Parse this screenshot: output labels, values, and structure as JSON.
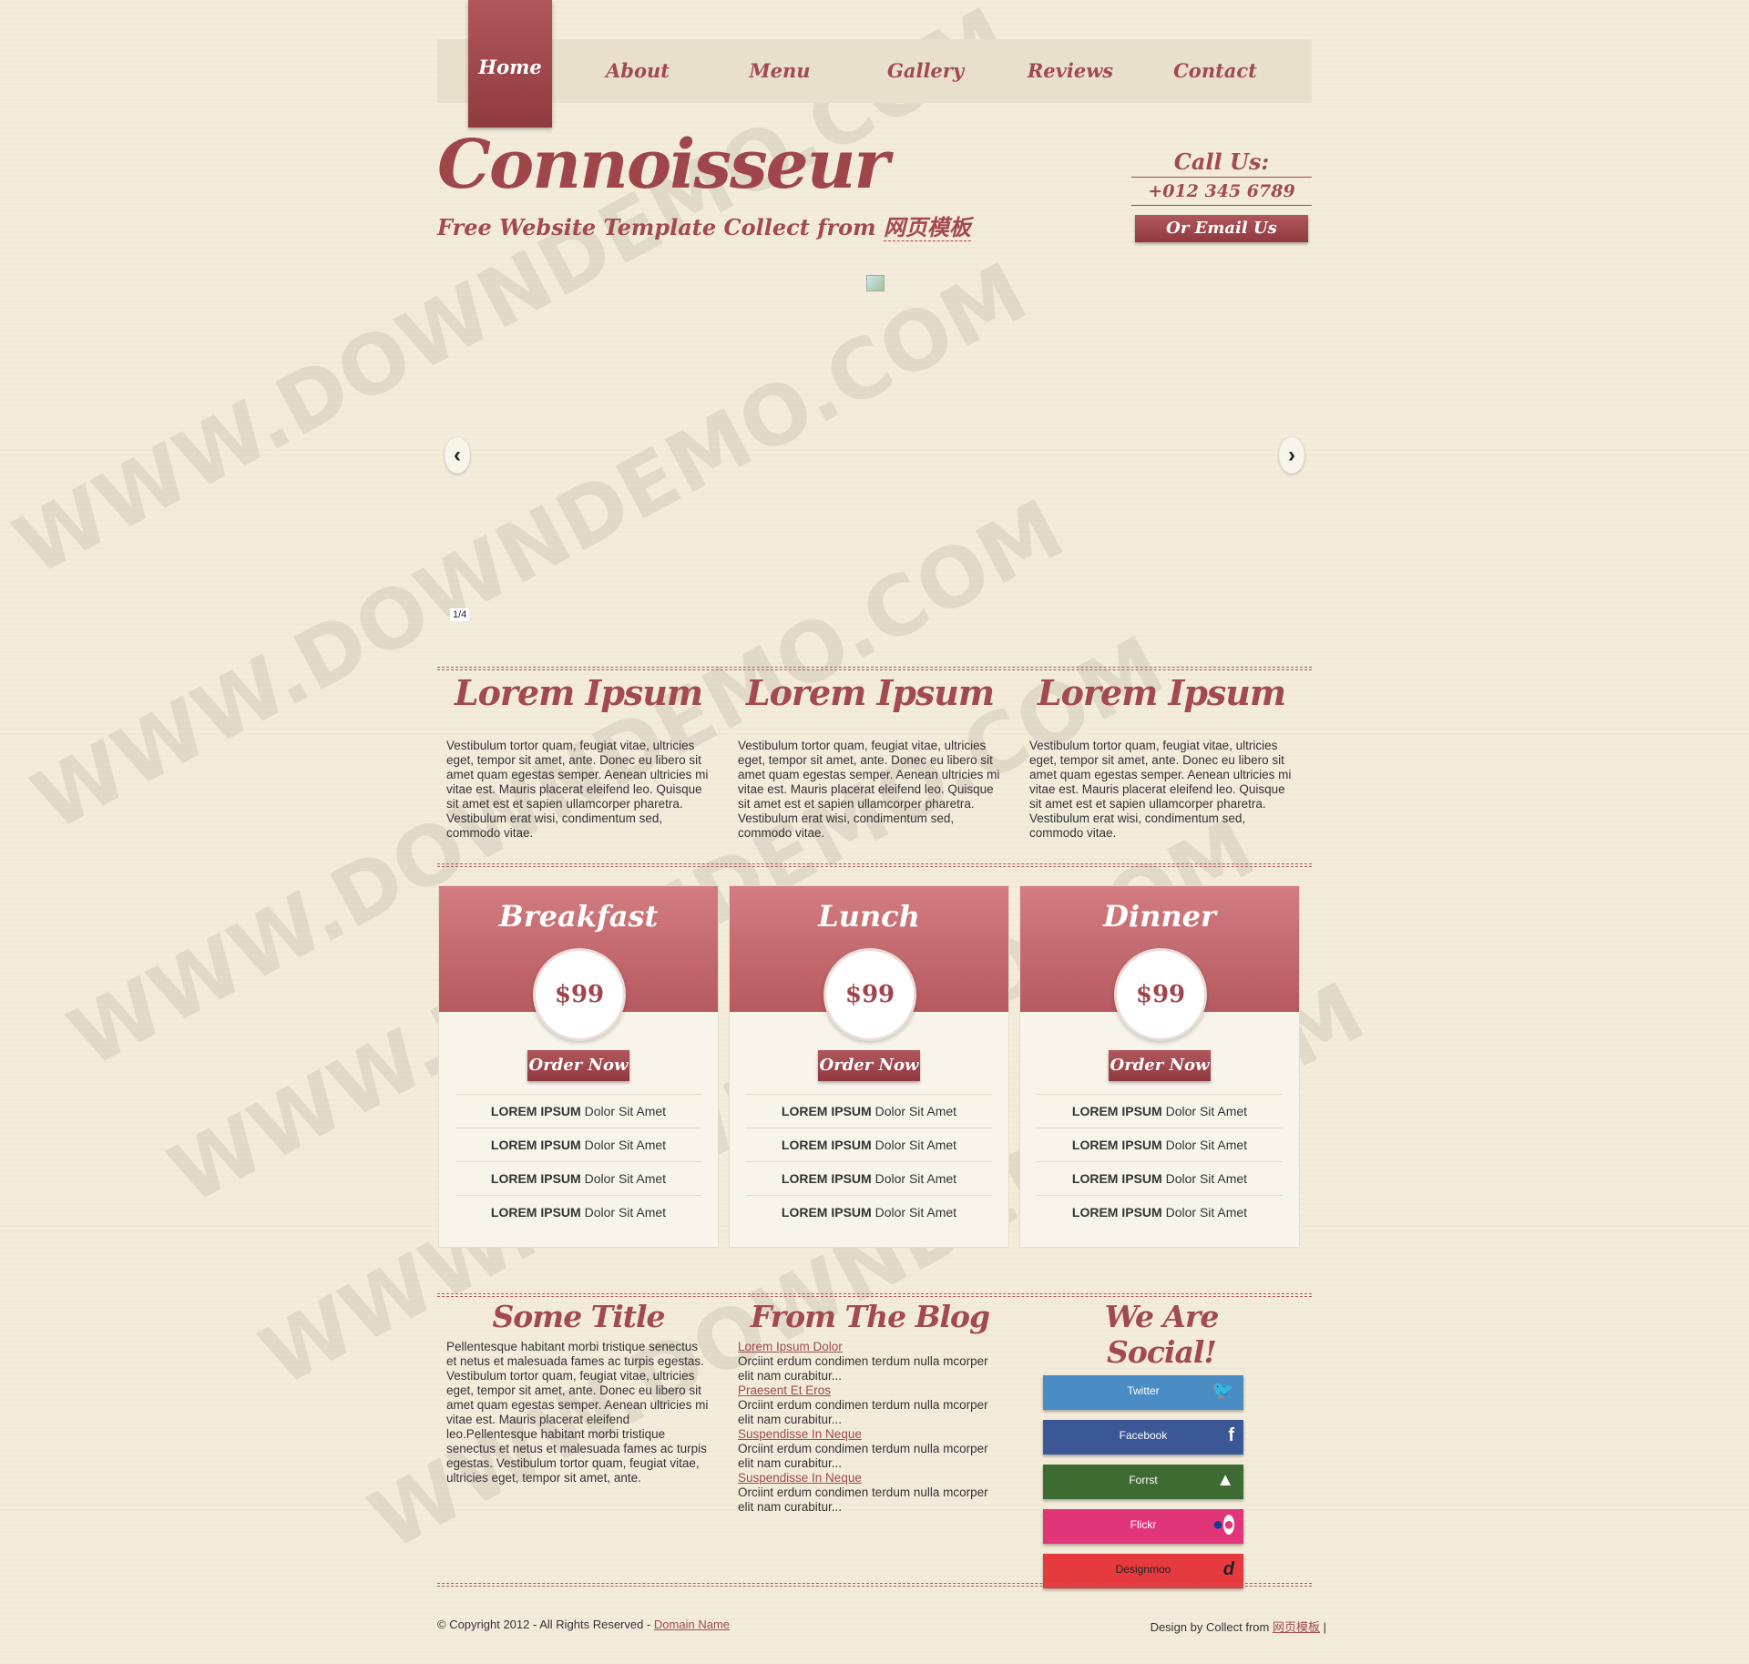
{
  "nav": {
    "home": "Home",
    "items": [
      "About",
      "Menu",
      "Gallery",
      "Reviews",
      "Contact"
    ]
  },
  "header": {
    "logo": "Connoisseur",
    "tagline_prefix": "Free Website Template Collect from",
    "tagline_link": "网页模板",
    "call_title": "Call Us:",
    "phone": "+012 345 6789",
    "email_button": "Or Email Us"
  },
  "slider": {
    "counter": "1/4",
    "prev_icon": "chevron-left-icon",
    "next_icon": "chevron-right-icon"
  },
  "intro": {
    "columns": [
      {
        "title": "Lorem Ipsum",
        "text": "Vestibulum tortor quam, feugiat vitae, ultricies eget, tempor sit amet, ante. Donec eu libero sit amet quam egestas semper. Aenean ultricies mi vitae est. Mauris placerat eleifend leo. Quisque sit amet est et sapien ullamcorper pharetra. Vestibulum erat wisi, condimentum sed, commodo vitae."
      },
      {
        "title": "Lorem Ipsum",
        "text": "Vestibulum tortor quam, feugiat vitae, ultricies eget, tempor sit amet, ante. Donec eu libero sit amet quam egestas semper. Aenean ultricies mi vitae est. Mauris placerat eleifend leo. Quisque sit amet est et sapien ullamcorper pharetra. Vestibulum erat wisi, condimentum sed, commodo vitae."
      },
      {
        "title": "Lorem Ipsum",
        "text": "Vestibulum tortor quam, feugiat vitae, ultricies eget, tempor sit amet, ante. Donec eu libero sit amet quam egestas semper. Aenean ultricies mi vitae est. Mauris placerat eleifend leo. Quisque sit amet est et sapien ullamcorper pharetra. Vestibulum erat wisi, condimentum sed, commodo vitae."
      }
    ]
  },
  "pricing": {
    "cards": [
      {
        "title": "Breakfast",
        "price": "$99",
        "button": "Order Now",
        "features": [
          {
            "bold": "LOREM IPSUM",
            "rest": " Dolor Sit Amet"
          },
          {
            "bold": "LOREM IPSUM",
            "rest": " Dolor Sit Amet"
          },
          {
            "bold": "LOREM IPSUM",
            "rest": " Dolor Sit Amet"
          },
          {
            "bold": "LOREM IPSUM",
            "rest": " Dolor Sit Amet"
          }
        ]
      },
      {
        "title": "Lunch",
        "price": "$99",
        "button": "Order Now",
        "features": [
          {
            "bold": "LOREM IPSUM",
            "rest": " Dolor Sit Amet"
          },
          {
            "bold": "LOREM IPSUM",
            "rest": " Dolor Sit Amet"
          },
          {
            "bold": "LOREM IPSUM",
            "rest": " Dolor Sit Amet"
          },
          {
            "bold": "LOREM IPSUM",
            "rest": " Dolor Sit Amet"
          }
        ]
      },
      {
        "title": "Dinner",
        "price": "$99",
        "button": "Order Now",
        "features": [
          {
            "bold": "LOREM IPSUM",
            "rest": " Dolor Sit Amet"
          },
          {
            "bold": "LOREM IPSUM",
            "rest": " Dolor Sit Amet"
          },
          {
            "bold": "LOREM IPSUM",
            "rest": " Dolor Sit Amet"
          },
          {
            "bold": "LOREM IPSUM",
            "rest": " Dolor Sit Amet"
          }
        ]
      }
    ]
  },
  "footer": {
    "some_title": "Some Title",
    "some_text": "Pellentesque habitant morbi tristique senectus et netus et malesuada fames ac turpis egestas. Vestibulum tortor quam, feugiat vitae, ultricies eget, tempor sit amet, ante. Donec eu libero sit amet quam egestas semper. Aenean ultricies mi vitae est. Mauris placerat eleifend leo.Pellentesque habitant morbi tristique senectus et netus et malesuada fames ac turpis egestas. Vestibulum tortor quam, feugiat vitae, ultricies eget, tempor sit amet, ante.",
    "blog_title": "From The Blog",
    "blog_posts": [
      {
        "title": "Lorem Ipsum Dolor",
        "text": "Orciint erdum condimen terdum nulla mcorper elit nam curabitur..."
      },
      {
        "title": "Praesent Et Eros",
        "text": "Orciint erdum condimen terdum nulla mcorper elit nam curabitur..."
      },
      {
        "title": "Suspendisse In Neque",
        "text": "Orciint erdum condimen terdum nulla mcorper elit nam curabitur..."
      },
      {
        "title": "Suspendisse In Neque",
        "text": "Orciint erdum condimen terdum nulla mcorper elit nam curabitur..."
      }
    ],
    "social_title": "We Are Social!",
    "social": [
      {
        "label": "Twitter",
        "icon": "twitter-icon",
        "color": "#4a8cc4"
      },
      {
        "label": "Facebook",
        "icon": "facebook-icon",
        "color": "#3b5796"
      },
      {
        "label": "Forrst",
        "icon": "forrst-icon",
        "color": "#3e6b32"
      },
      {
        "label": "Flickr",
        "icon": "flickr-icon",
        "color": "#e1357a"
      },
      {
        "label": "Designmoo",
        "icon": "designmoo-icon",
        "color": "#e53a3e"
      }
    ],
    "copyright_prefix": "© Copyright 2012 - All Rights Reserved -",
    "copyright_link": "Domain Name",
    "design_prefix": "Design by Collect from",
    "design_link": "网页模板",
    "design_suffix": "|"
  },
  "watermark": "WWW.DOWNDEMO.COM",
  "colors": {
    "accent": "#a24a4f",
    "background": "#f3ecdb",
    "card_header": "#c66b70"
  }
}
